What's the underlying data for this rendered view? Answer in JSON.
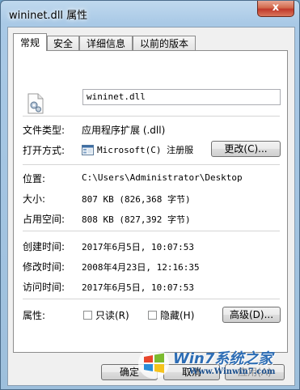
{
  "window": {
    "title": "wininet.dll 属性",
    "close_glyph": "x"
  },
  "tabs": [
    {
      "label": "常规",
      "active": true
    },
    {
      "label": "安全"
    },
    {
      "label": "详细信息"
    },
    {
      "label": "以前的版本"
    }
  ],
  "general": {
    "file_name": "wininet.dll",
    "file_type_label": "文件类型:",
    "file_type_value": "应用程序扩展 (.dll)",
    "open_with_label": "打开方式:",
    "open_with_value": "Microsoft(C) 注册服",
    "change_button": "更改(C)...",
    "location_label": "位置:",
    "location_value": "C:\\Users\\Administrator\\Desktop",
    "size_label": "大小:",
    "size_value": "807 KB (826,368 字节)",
    "size_on_disk_label": "占用空间:",
    "size_on_disk_value": "808 KB (827,392 字节)",
    "created_label": "创建时间:",
    "created_value": "2017年6月5日, 10:07:53",
    "modified_label": "修改时间:",
    "modified_value": "2008年4月23日, 12:16:35",
    "accessed_label": "访问时间:",
    "accessed_value": "2017年6月5日, 10:07:53",
    "attributes_label": "属性:",
    "readonly_label": "只读(R)",
    "hidden_label": "隐藏(H)",
    "advanced_button": "高级(D)..."
  },
  "footer": {
    "ok_button": "确定",
    "cancel_button": "取消",
    "apply_button": "应用(A)"
  },
  "watermark": {
    "brand": "Win7系统之家",
    "url": "Www.Winwin7.com"
  }
}
